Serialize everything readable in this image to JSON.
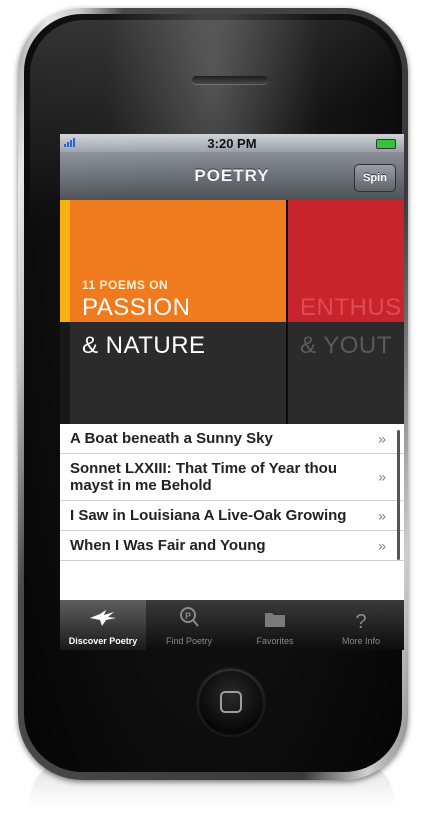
{
  "status_bar": {
    "time": "3:20 PM"
  },
  "nav": {
    "title": "POETRY",
    "spin_label": "Spin"
  },
  "hero": {
    "current": {
      "kicker": "11 POEMS ON",
      "line1": "PASSION",
      "line2": "& NATURE",
      "top_color": "#f07a1e",
      "accent_color": "#f5b111"
    },
    "next": {
      "line1": "ENTHUS",
      "line2": "& YOUT",
      "top_color": "#c8242c"
    }
  },
  "poems": [
    {
      "title": "A Boat beneath a Sunny Sky"
    },
    {
      "title": "Sonnet LXXIII: That Time of Year thou mayst in me Behold"
    },
    {
      "title": "I Saw in Louisiana A Live-Oak Growing"
    },
    {
      "title": "When I Was Fair and Young"
    }
  ],
  "chevron": "»",
  "tabs": [
    {
      "label": "Discover Poetry",
      "icon": "pegasus-icon",
      "active": true
    },
    {
      "label": "Find Poetry",
      "icon": "search-p-icon",
      "active": false
    },
    {
      "label": "Favorites",
      "icon": "folder-icon",
      "active": false
    },
    {
      "label": "More Info",
      "icon": "question-icon",
      "active": false
    }
  ]
}
